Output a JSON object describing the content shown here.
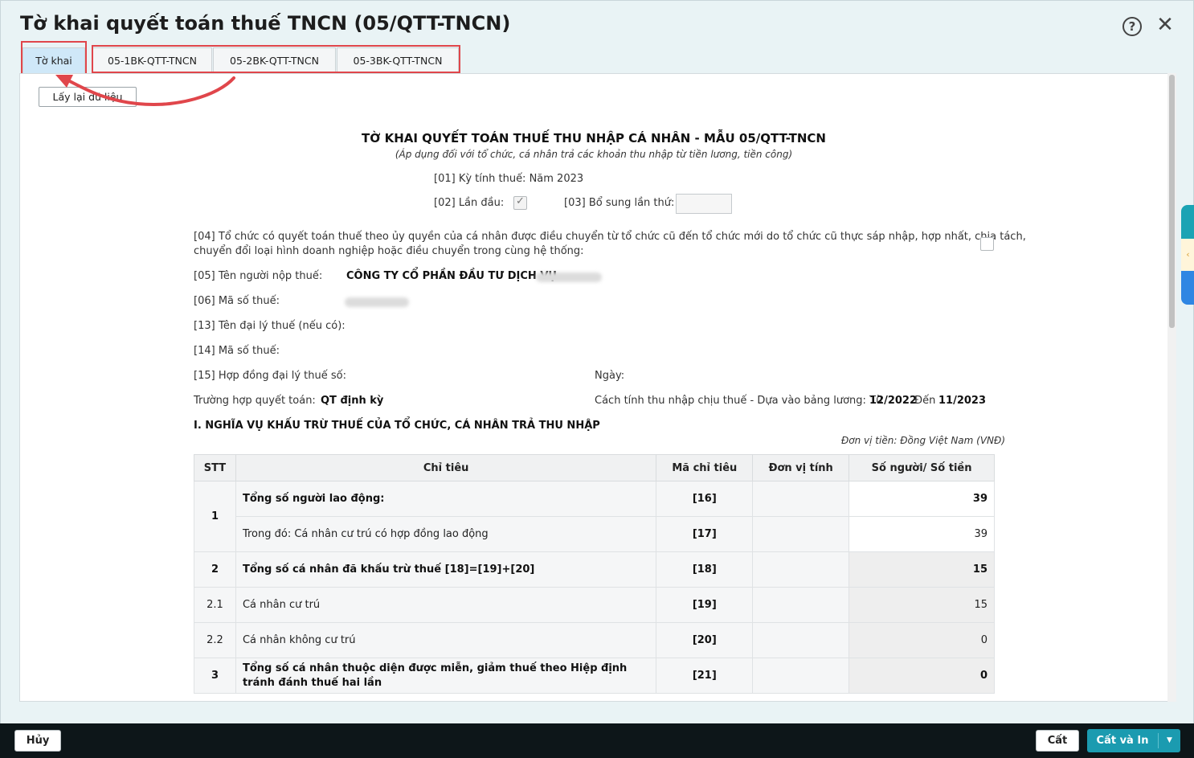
{
  "window": {
    "title": "Tờ khai quyết toán thuế TNCN (05/QTT-TNCN)",
    "help_glyph": "?",
    "close_glyph": "✕"
  },
  "tabs": [
    {
      "label": "Tờ khai",
      "active": true
    },
    {
      "label": "05-1BK-QTT-TNCN",
      "active": false
    },
    {
      "label": "05-2BK-QTT-TNCN",
      "active": false
    },
    {
      "label": "05-3BK-QTT-TNCN",
      "active": false
    }
  ],
  "toolbar": {
    "reload_label": "Lấy lại dữ liệu"
  },
  "document": {
    "title": "TỜ KHAI QUYẾT TOÁN THUẾ THU NHẬP CÁ NHÂN - MẪU 05/QTT-TNCN",
    "subtitle": "(Áp dụng đối với tổ chức, cá nhân trả các khoản thu nhập từ tiền lương, tiền công)",
    "period": "[01] Kỳ tính thuế: Năm 2023",
    "first_time_label": "[02] Lần đầu:",
    "first_time_checked": true,
    "supplement_label": "[03] Bổ sung lần thứ:",
    "supplement_value": "",
    "item04_line1": "[04] Tổ chức có quyết toán thuế theo ủy quyền của cá nhân được điều chuyển từ tổ chức cũ đến tổ chức mới do tổ chức cũ thực sáp nhập, hợp nhất, chia tách,",
    "item04_line2": "chuyển đổi loại hình doanh nghiệp hoặc điều chuyển trong cùng hệ thống:",
    "item04_checked": false,
    "taxpayer_name_label": "[05] Tên người nộp thuế:",
    "taxpayer_name_value": "CÔNG TY CỔ PHẦN ĐẦU TƯ DỊCH VỤ",
    "tax_code_label": "[06] Mã số thuế:",
    "agent_name_label": "[13] Tên đại lý thuế (nếu có):",
    "agent_tax_code_label": "[14] Mã số thuế:",
    "agent_contract_label": "[15] Hợp đồng đại lý thuế số:",
    "date_label": "Ngày:",
    "case_label": "Trường hợp quyết toán:",
    "case_value": "QT định kỳ",
    "income_method_label": "Cách tính thu nhập chịu thuế - Dựa vào bảng lương: Từ",
    "income_from": "12/2022",
    "income_to_label": "Đến",
    "income_to": "11/2023",
    "section1_title": "I. NGHĨA VỤ KHẤU TRỪ THUẾ CỦA TỔ CHỨC, CÁ NHÂN TRẢ THU NHẬP",
    "currency_note": "Đơn vị tiền: Đồng Việt Nam (VNĐ)"
  },
  "table": {
    "headers": {
      "stt": "STT",
      "item": "Chỉ tiêu",
      "code": "Mã chỉ tiêu",
      "unit": "Đơn vị tính",
      "value": "Số người/ Số tiền"
    },
    "rows": [
      {
        "stt": "1",
        "item": "Tổng số người lao động:",
        "code": "[16]",
        "unit": "",
        "value": "39"
      },
      {
        "stt": "",
        "item": "Trong đó: Cá nhân cư trú có hợp đồng lao động",
        "code": "[17]",
        "unit": "",
        "value": "39"
      },
      {
        "stt": "2",
        "item": "Tổng số cá nhân đã khấu trừ thuế [18]=[19]+[20]",
        "code": "[18]",
        "unit": "",
        "value": "15"
      },
      {
        "stt": "2.1",
        "item": "Cá nhân cư trú",
        "code": "[19]",
        "unit": "",
        "value": "15"
      },
      {
        "stt": "2.2",
        "item": "Cá nhân không cư trú",
        "code": "[20]",
        "unit": "",
        "value": "0"
      },
      {
        "stt": "3",
        "item": "Tổng số cá nhân thuộc diện được miễn, giảm thuế theo Hiệp định tránh đánh thuế hai lần",
        "code": "[21]",
        "unit": "",
        "value": "0"
      }
    ]
  },
  "footer": {
    "cancel_label": "Hủy",
    "save_label": "Cất",
    "save_print_label": "Cất và In",
    "dropdown_glyph": "▼"
  },
  "side_widget": {
    "glyph": "‹"
  },
  "colors": {
    "accent": "#1b9bb0",
    "highlight": "#e0464b",
    "active_tab": "#cfe8f8"
  }
}
